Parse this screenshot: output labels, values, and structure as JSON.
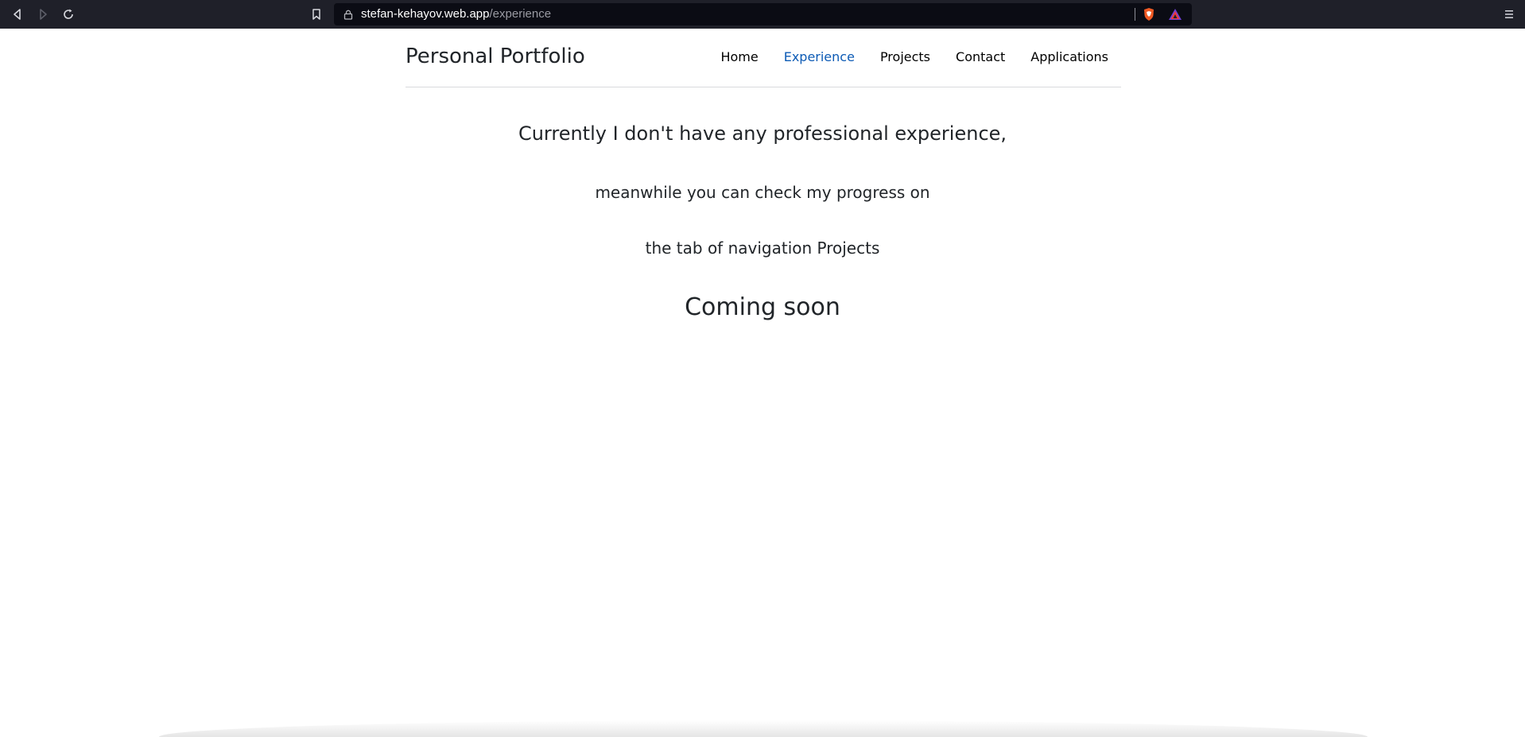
{
  "browser": {
    "url_host": "stefan-kehayov.web.app",
    "url_path": "/experience"
  },
  "site": {
    "brand": "Personal Portfolio",
    "nav": [
      {
        "label": "Home",
        "active": false
      },
      {
        "label": "Experience",
        "active": true
      },
      {
        "label": "Projects",
        "active": false
      },
      {
        "label": "Contact",
        "active": false
      },
      {
        "label": "Applications",
        "active": false
      }
    ]
  },
  "content": {
    "line1": "Currently I don't have any professional experience,",
    "line2": "meanwhile you can check my progress on",
    "line3": "the tab of navigation Projects",
    "line4": "Coming soon"
  },
  "colors": {
    "active_nav": "#0d5bb5",
    "chrome_bg": "#1f2029"
  },
  "icons": [
    "back-icon",
    "forward-icon",
    "reload-icon",
    "bookmark-icon",
    "lock-icon",
    "brave-shield-icon",
    "brave-rewards-icon",
    "menu-icon"
  ]
}
